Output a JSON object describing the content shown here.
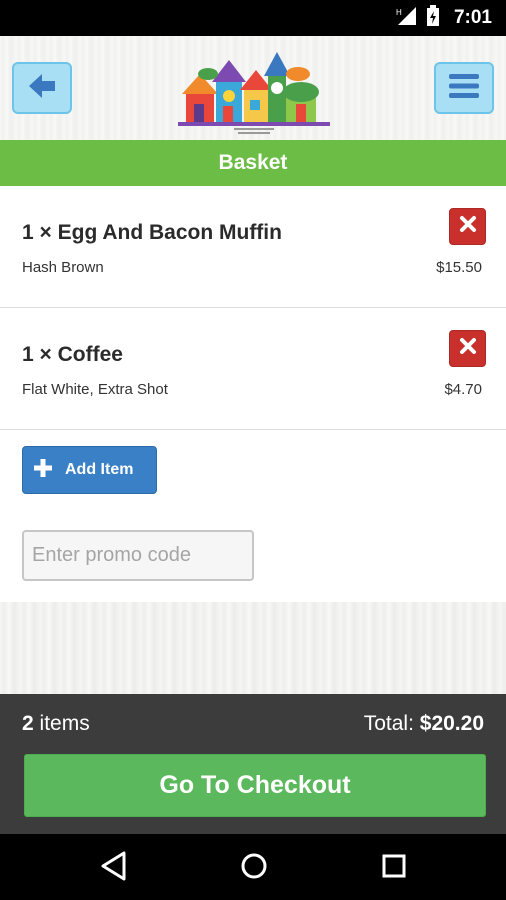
{
  "status_bar": {
    "time": "7:01",
    "icons": [
      "signal-icon",
      "battery-charging-icon"
    ]
  },
  "header": {
    "back_icon": "arrow-left-icon",
    "menu_icon": "hamburger-menu-icon",
    "logo": "village-houses-logo",
    "colors": {
      "button_bg": "#a9dff4",
      "button_border": "#6cc4e8",
      "icon": "#3a79c0"
    }
  },
  "page": {
    "title": "Basket",
    "title_bar_color": "#6cbd45"
  },
  "basket": {
    "items": [
      {
        "name": "1 × Egg And Bacon Muffin",
        "options": "Hash Brown",
        "price": "$15.50",
        "remove_icon": "close-x-icon"
      },
      {
        "name": "1 × Coffee",
        "options": "Flat White, Extra Shot",
        "price": "$4.70",
        "remove_icon": "close-x-icon"
      }
    ],
    "add_item_label": "Add Item",
    "add_item_icon": "plus-icon",
    "promo_placeholder": "Enter promo code",
    "promo_value": ""
  },
  "footer": {
    "count_number": "2",
    "count_label": "items",
    "total_label": "Total:",
    "total_value": "$20.20",
    "checkout_label": "Go To Checkout",
    "colors": {
      "background": "#3c3c3c",
      "checkout": "#5cb85c"
    }
  },
  "nav_bar": {
    "back_icon": "nav-back-triangle-icon",
    "home_icon": "nav-home-circle-icon",
    "recents_icon": "nav-recents-square-icon"
  }
}
